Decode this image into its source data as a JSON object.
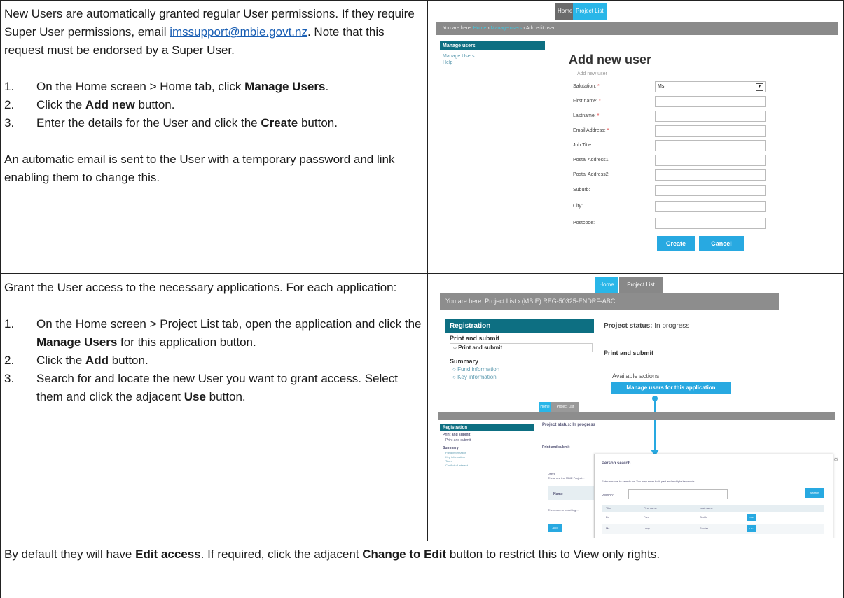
{
  "row1": {
    "intro": "New Users are automatically granted regular User permissions. If they require Super User permissions, email ",
    "email": "imssupport@mbie.govt.nz",
    "intro_end": ". Note that this request must be endorsed by a Super User.",
    "steps": [
      {
        "num": "1.",
        "pre": "On the Home screen > Home tab, click ",
        "bold": "Manage Users",
        "post": "."
      },
      {
        "num": "2.",
        "pre": "Click the ",
        "bold": "Add new",
        "post": " button."
      },
      {
        "num": "3.",
        "pre": "Enter the details for the User and click the ",
        "bold": "Create",
        "post": " button."
      }
    ],
    "closing": "An automatic email is sent to the User with a temporary password and link enabling them to change this."
  },
  "row2": {
    "intro": "Grant the User access to the necessary applications. For each application:",
    "steps": [
      {
        "num": "1.",
        "pre": "On the Home screen > Project List tab, open the application and click the ",
        "bold": "Manage Users",
        "post": " for this application button."
      },
      {
        "num": "2.",
        "pre": "Click the ",
        "bold": "Add",
        "post": " button."
      },
      {
        "num": "3.",
        "pre": "Search for and locate the new User you want to grant access. Select them and click the adjacent ",
        "bold": "Use",
        "post": " button."
      }
    ]
  },
  "row3": {
    "pre": "By default they will have ",
    "bold1": "Edit access",
    "mid": ". If required, click the adjacent ",
    "bold2": "Change to Edit",
    "post": " button to restrict this to View only rights."
  },
  "shot1": {
    "tabs": [
      "Home",
      "Project List"
    ],
    "crumb_prefix": "You are here: ",
    "crumb_home": "Home",
    "crumb_sep": " › ",
    "crumb_manage": "Manage users",
    "crumb_last": " › Add edit user",
    "side_header": "Manage users",
    "side_items": [
      "Manage Users",
      "Help"
    ],
    "title": "Add new user",
    "subtitle": "Add new user",
    "fields": [
      {
        "label": "Salutation:",
        "req": " *",
        "value": "Ms",
        "select": true
      },
      {
        "label": "First name:",
        "req": " *"
      },
      {
        "label": "Lastname:",
        "req": " *"
      },
      {
        "label": "Email Address:",
        "req": " *"
      },
      {
        "label": "Job Title:",
        "req": ""
      },
      {
        "label": "Postal Address1:",
        "req": ""
      },
      {
        "label": "Postal Address2:",
        "req": ""
      },
      {
        "label": "Suburb:",
        "req": ""
      },
      {
        "label": "City:",
        "req": ""
      },
      {
        "label": "Postcode:",
        "req": ""
      }
    ],
    "create": "Create",
    "cancel": "Cancel",
    "colors": {
      "accent": "#28a9e1",
      "nav": "#0d6f82",
      "crumb": "#8a8a8a"
    }
  },
  "shot2": {
    "tabs": [
      "Home",
      "Project List"
    ],
    "crumb": "You are here: Project List › (MBIE) REG-50325-ENDRF-ABC",
    "side_header": "Registration",
    "side_group1": "Print and submit",
    "side_item1": "Print and submit",
    "side_group2": "Summary",
    "side_item2": "Fund information",
    "side_item3": "Key information",
    "status_label": "Project status:",
    "status_value": " In progress",
    "section": "Print and submit",
    "actions_label": "Available actions",
    "manage_btn": "Manage users for this application",
    "lower": {
      "tabs": [
        "Home",
        "Project List"
      ],
      "side_header": "Registration",
      "side_group1": "Print and submit",
      "side_item1": "Print and submit",
      "side_group2": "Summary",
      "side_items": [
        "Fund information",
        "Key information",
        "Team",
        "Conflict of interest"
      ],
      "status": "Project status: In progress",
      "section": "Print and submit",
      "users_heading": "Users",
      "users_text": "These are the MBIE Project...",
      "name_head": "Name",
      "no_match": "There are no matching...",
      "add_btn": "Add",
      "dialog_title": "Person search",
      "dialog_hint": "Enter a name to search for. You may enter both part and multiple keywords.",
      "person_label": "Person:",
      "search_btn": "Search",
      "cols": [
        "Title",
        "First name",
        "Last name"
      ],
      "rows": [
        [
          "Dr",
          "Fred",
          "Smith"
        ],
        [
          "Ms",
          "Lucy",
          "Fowler"
        ]
      ],
      "use_btn": "Use"
    }
  }
}
